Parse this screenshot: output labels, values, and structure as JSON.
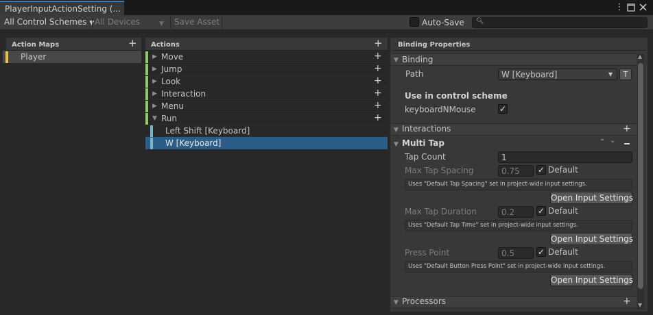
{
  "window": {
    "tab_title": "PlayerInputActionSetting (...",
    "more_icon": "vertical-ellipsis-icon",
    "maximize_icon": "maximize-icon",
    "close_icon": "close-icon"
  },
  "toolbar": {
    "control_schemes": "All Control Schemes",
    "devices": "All Devices",
    "save_asset": "Save Asset",
    "auto_save_label": "Auto-Save",
    "auto_save_checked": false,
    "search_placeholder": ""
  },
  "action_maps": {
    "header": "Action Maps",
    "items": [
      {
        "label": "Player",
        "color": "#e8c34a"
      }
    ]
  },
  "actions": {
    "header": "Actions",
    "items": [
      {
        "label": "Move"
      },
      {
        "label": "Jump"
      },
      {
        "label": "Look"
      },
      {
        "label": "Interaction"
      },
      {
        "label": "Menu"
      },
      {
        "label": "Run",
        "expanded": true
      }
    ],
    "bindings": [
      {
        "label": "Left Shift [Keyboard]"
      },
      {
        "label": "W [Keyboard]",
        "selected": true
      }
    ],
    "action_color": "#8fc96c",
    "binding_color": "#7ab4c8"
  },
  "binding_properties": {
    "header": "Binding Properties",
    "binding_section": "Binding",
    "path_label": "Path",
    "path_value": "W [Keyboard]",
    "t_button": "T",
    "use_in_scheme": "Use in control scheme",
    "scheme_name": "keyboardNMouse",
    "scheme_checked": true,
    "interactions_section": "Interactions",
    "multi_tap": {
      "title": "Multi Tap",
      "tap_count_label": "Tap Count",
      "tap_count_value": "1",
      "spacing_label": "Max Tap Spacing",
      "spacing_value": "0.75",
      "spacing_default": "Default",
      "spacing_help": "Uses \"Default Tap Spacing\" set in project-wide input settings.",
      "duration_label": "Max Tap Duration",
      "duration_value": "0.2",
      "duration_default": "Default",
      "duration_help": "Uses \"Default Tap Time\" set in project-wide input settings.",
      "press_label": "Press Point",
      "press_value": "0.5",
      "press_default": "Default",
      "press_help": "Uses \"Default Button Press Point\" set in project-wide input settings.",
      "open_settings": "Open Input Settings"
    },
    "processors_section": "Processors"
  },
  "colors": {
    "selection": "#2c5d87",
    "accent": "#3a79bb"
  }
}
